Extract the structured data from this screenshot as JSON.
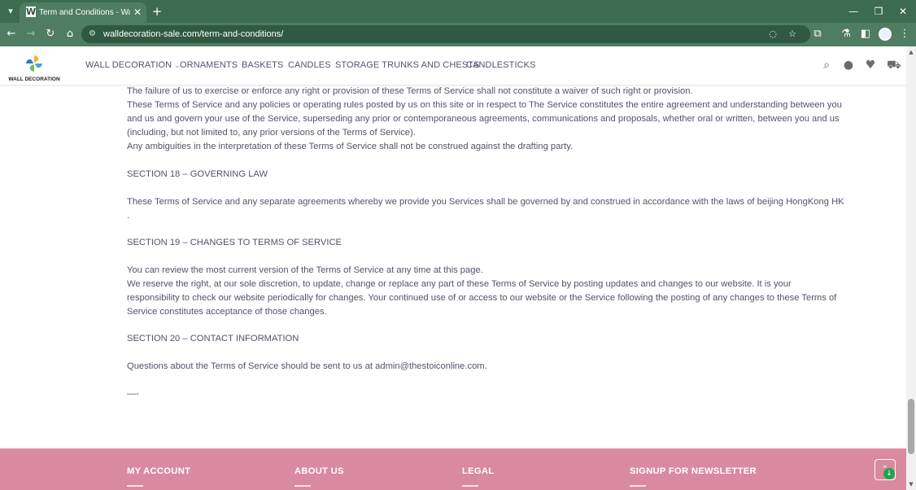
{
  "browser": {
    "tab_title": "Term and Conditions - Wall Decoration",
    "tab_favicon": "W",
    "url": "walldecoration-sale.com/term-and-conditions/",
    "icons": {
      "tab_list": "chevron-down-icon",
      "close_tab": "close-icon",
      "new_tab": "plus-icon",
      "back": "arrow-left-icon",
      "forward": "arrow-right-icon",
      "reload": "reload-icon",
      "home": "home-icon",
      "site_info": "tune-icon",
      "eye_off": "eye-off-icon",
      "bookmark": "star-icon",
      "extensions": "puzzle-icon",
      "labs": "flask-icon",
      "side_panel": "side-panel-icon",
      "menu": "kebab-icon"
    },
    "chrome_colors": {
      "tabbar": "#3c6b4f",
      "toolbar": "#4f7d61"
    }
  },
  "site": {
    "logo_text": "WALL DECORATION",
    "nav": [
      {
        "label": "WALL DECORATION",
        "has_dropdown": true
      },
      {
        "label": "ORNAMENTS"
      },
      {
        "label": "BASKETS"
      },
      {
        "label": "CANDLES"
      },
      {
        "label": "STORAGE TRUNKS AND CHESTS"
      },
      {
        "label": "CANDLESTICKS"
      }
    ],
    "header_icons": [
      "search-icon",
      "user-icon",
      "heart-icon",
      "cart-icon"
    ],
    "nav_color": "#5c4f6e"
  },
  "content": {
    "text_color": "#57506a",
    "lines": [
      "The failure of us to exercise or enforce any right or provision of these Terms of Service shall not constitute a waiver of such right or provision.",
      "These Terms of Service and any policies or operating rules posted by us on this site or in respect to The Service constitutes the entire agreement and understanding between you",
      "and us and govern your use of the Service, superseding any prior or contemporaneous agreements, communications and proposals, whether oral or written, between you and us",
      "(including, but not limited to, any prior versions of the Terms of Service).",
      "Any ambiguities in the interpretation of these Terms of Service shall not be construed against the drafting party.",
      "SECTION 18 – GOVERNING LAW",
      "These Terms of Service and any separate agreements whereby we provide you Services shall be governed by and construed in accordance with the laws of beijing HongKong HK",
      ".",
      "SECTION 19 – CHANGES TO TERMS OF SERVICE",
      "You can review the most current version of the Terms of Service at any time at this page.",
      "We reserve the right, at our sole discretion, to update, change or replace any part of these Terms of Service by posting updates and changes to our website. It is your",
      "responsibility to check our website periodically for changes. Your continued use of or access to our website or the Service following the posting of any changes to these Terms of",
      "Service constitutes acceptance of those changes.",
      "SECTION 20 – CONTACT INFORMATION",
      "Questions about the Terms of Service should be sent to us at admin@thestoiconline.com.",
      "—-"
    ]
  },
  "footer": {
    "background": "#d98aa0",
    "columns": [
      "MY ACCOUNT",
      "ABOUT US",
      "LEGAL",
      "SIGNUP FOR NEWSLETTER"
    ],
    "back_to_top_icon": "chevron-up-icon"
  }
}
